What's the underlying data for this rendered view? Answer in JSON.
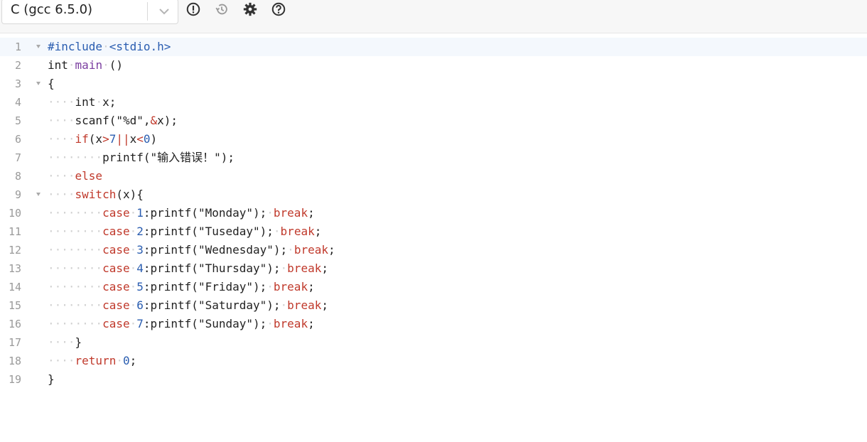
{
  "toolbar": {
    "language": "C (gcc 6.5.0)",
    "icons": [
      "alert-icon",
      "history-icon",
      "gear-icon",
      "help-icon"
    ]
  },
  "editor": {
    "active_line": 1,
    "lines": [
      {
        "n": "1",
        "fold": true,
        "tokens": [
          {
            "t": "#include",
            "c": "pre"
          },
          {
            "t": "·",
            "c": "ws"
          },
          {
            "t": "<stdio.h>",
            "c": "pre"
          }
        ]
      },
      {
        "n": "2",
        "fold": false,
        "tokens": [
          {
            "t": "int",
            "c": ""
          },
          {
            "t": "·",
            "c": "ws"
          },
          {
            "t": "main",
            "c": "fn"
          },
          {
            "t": "·",
            "c": "ws"
          },
          {
            "t": "()",
            "c": ""
          }
        ]
      },
      {
        "n": "3",
        "fold": true,
        "tokens": [
          {
            "t": "{",
            "c": ""
          }
        ]
      },
      {
        "n": "4",
        "fold": false,
        "tokens": [
          {
            "t": "····",
            "c": "ws"
          },
          {
            "t": "int",
            "c": ""
          },
          {
            "t": "·",
            "c": "ws"
          },
          {
            "t": "x;",
            "c": ""
          }
        ]
      },
      {
        "n": "5",
        "fold": false,
        "tokens": [
          {
            "t": "····",
            "c": "ws"
          },
          {
            "t": "scanf(\"%d\",",
            "c": ""
          },
          {
            "t": "&",
            "c": "op"
          },
          {
            "t": "x);",
            "c": ""
          }
        ]
      },
      {
        "n": "6",
        "fold": false,
        "tokens": [
          {
            "t": "····",
            "c": "ws"
          },
          {
            "t": "if",
            "c": "kw"
          },
          {
            "t": "(x",
            "c": ""
          },
          {
            "t": ">",
            "c": "op"
          },
          {
            "t": "7",
            "c": "num"
          },
          {
            "t": "||",
            "c": "op"
          },
          {
            "t": "x",
            "c": ""
          },
          {
            "t": "<",
            "c": "op"
          },
          {
            "t": "0",
            "c": "num"
          },
          {
            "t": ")",
            "c": ""
          }
        ]
      },
      {
        "n": "7",
        "fold": false,
        "tokens": [
          {
            "t": "········",
            "c": "ws"
          },
          {
            "t": "printf(\"输入错误！\");",
            "c": ""
          }
        ]
      },
      {
        "n": "8",
        "fold": false,
        "tokens": [
          {
            "t": "····",
            "c": "ws"
          },
          {
            "t": "else",
            "c": "kw"
          }
        ]
      },
      {
        "n": "9",
        "fold": true,
        "tokens": [
          {
            "t": "····",
            "c": "ws"
          },
          {
            "t": "switch",
            "c": "kw"
          },
          {
            "t": "(x){",
            "c": ""
          }
        ]
      },
      {
        "n": "10",
        "fold": false,
        "tokens": [
          {
            "t": "········",
            "c": "ws"
          },
          {
            "t": "case",
            "c": "kw"
          },
          {
            "t": "·",
            "c": "ws"
          },
          {
            "t": "1",
            "c": "num"
          },
          {
            "t": ":printf(\"Monday\");",
            "c": ""
          },
          {
            "t": "·",
            "c": "ws"
          },
          {
            "t": "break",
            "c": "kw"
          },
          {
            "t": ";",
            "c": ""
          }
        ]
      },
      {
        "n": "11",
        "fold": false,
        "tokens": [
          {
            "t": "········",
            "c": "ws"
          },
          {
            "t": "case",
            "c": "kw"
          },
          {
            "t": "·",
            "c": "ws"
          },
          {
            "t": "2",
            "c": "num"
          },
          {
            "t": ":printf(\"Tuseday\");",
            "c": ""
          },
          {
            "t": "·",
            "c": "ws"
          },
          {
            "t": "break",
            "c": "kw"
          },
          {
            "t": ";",
            "c": ""
          }
        ]
      },
      {
        "n": "12",
        "fold": false,
        "tokens": [
          {
            "t": "········",
            "c": "ws"
          },
          {
            "t": "case",
            "c": "kw"
          },
          {
            "t": "·",
            "c": "ws"
          },
          {
            "t": "3",
            "c": "num"
          },
          {
            "t": ":printf(\"Wednesday\");",
            "c": ""
          },
          {
            "t": "·",
            "c": "ws"
          },
          {
            "t": "break",
            "c": "kw"
          },
          {
            "t": ";",
            "c": ""
          }
        ]
      },
      {
        "n": "13",
        "fold": false,
        "tokens": [
          {
            "t": "········",
            "c": "ws"
          },
          {
            "t": "case",
            "c": "kw"
          },
          {
            "t": "·",
            "c": "ws"
          },
          {
            "t": "4",
            "c": "num"
          },
          {
            "t": ":printf(\"Thursday\");",
            "c": ""
          },
          {
            "t": "·",
            "c": "ws"
          },
          {
            "t": "break",
            "c": "kw"
          },
          {
            "t": ";",
            "c": ""
          }
        ]
      },
      {
        "n": "14",
        "fold": false,
        "tokens": [
          {
            "t": "········",
            "c": "ws"
          },
          {
            "t": "case",
            "c": "kw"
          },
          {
            "t": "·",
            "c": "ws"
          },
          {
            "t": "5",
            "c": "num"
          },
          {
            "t": ":printf(\"Friday\");",
            "c": ""
          },
          {
            "t": "·",
            "c": "ws"
          },
          {
            "t": "break",
            "c": "kw"
          },
          {
            "t": ";",
            "c": ""
          }
        ]
      },
      {
        "n": "15",
        "fold": false,
        "tokens": [
          {
            "t": "········",
            "c": "ws"
          },
          {
            "t": "case",
            "c": "kw"
          },
          {
            "t": "·",
            "c": "ws"
          },
          {
            "t": "6",
            "c": "num"
          },
          {
            "t": ":printf(\"Saturday\");",
            "c": ""
          },
          {
            "t": "·",
            "c": "ws"
          },
          {
            "t": "break",
            "c": "kw"
          },
          {
            "t": ";",
            "c": ""
          }
        ]
      },
      {
        "n": "16",
        "fold": false,
        "tokens": [
          {
            "t": "········",
            "c": "ws"
          },
          {
            "t": "case",
            "c": "kw"
          },
          {
            "t": "·",
            "c": "ws"
          },
          {
            "t": "7",
            "c": "num"
          },
          {
            "t": ":printf(\"Sunday\");",
            "c": ""
          },
          {
            "t": "·",
            "c": "ws"
          },
          {
            "t": "break",
            "c": "kw"
          },
          {
            "t": ";",
            "c": ""
          }
        ]
      },
      {
        "n": "17",
        "fold": false,
        "tokens": [
          {
            "t": "····",
            "c": "ws"
          },
          {
            "t": "}",
            "c": ""
          }
        ]
      },
      {
        "n": "18",
        "fold": false,
        "tokens": [
          {
            "t": "····",
            "c": "ws"
          },
          {
            "t": "return",
            "c": "kw"
          },
          {
            "t": "·",
            "c": "ws"
          },
          {
            "t": "0",
            "c": "num"
          },
          {
            "t": ";",
            "c": ""
          }
        ]
      },
      {
        "n": "19",
        "fold": false,
        "tokens": [
          {
            "t": "}",
            "c": ""
          }
        ]
      }
    ]
  }
}
